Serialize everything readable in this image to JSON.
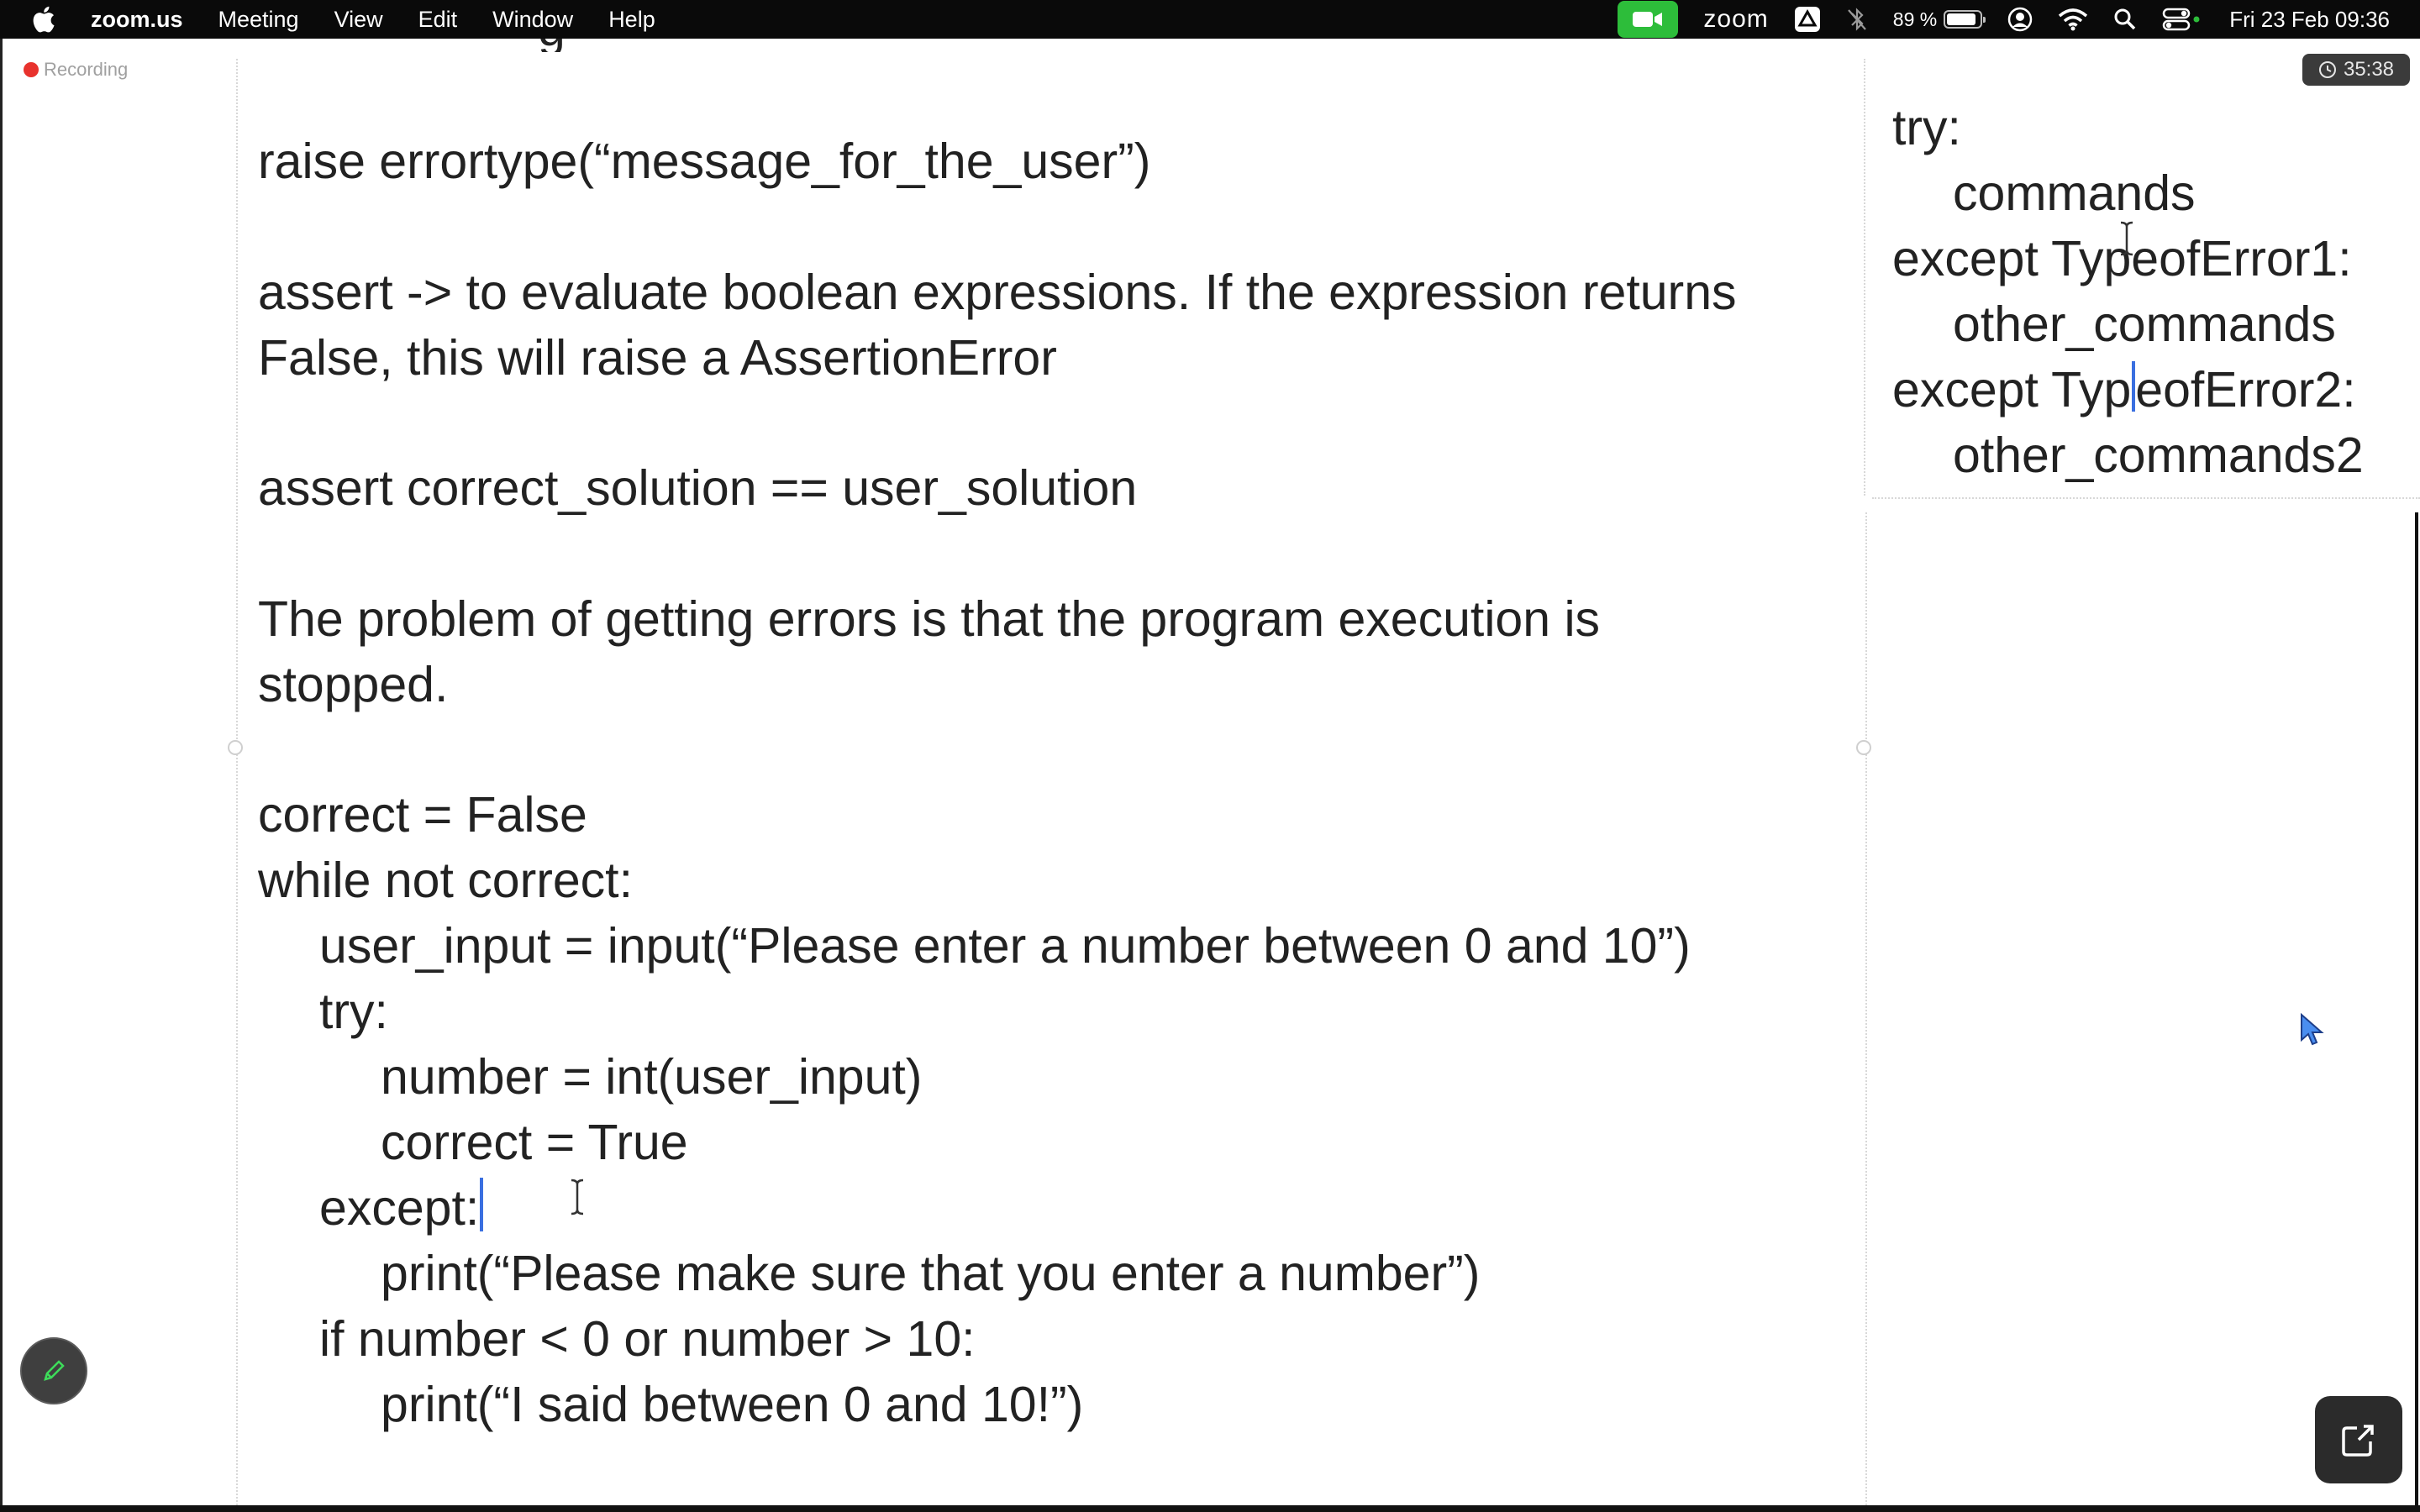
{
  "menubar": {
    "app_name": "zoom.us",
    "menus": [
      "Meeting",
      "View",
      "Edit",
      "Window",
      "Help"
    ],
    "zoom_label": "zoom",
    "battery_percent": "89 %",
    "battery_level": 0.89,
    "clock": "Fri 23 Feb  09:36"
  },
  "recording": {
    "label": "Recording"
  },
  "timer": {
    "elapsed": "35:38"
  },
  "document": {
    "lines": [
      "raise errortype(“message_for_the_user”)",
      "assert -> to evaluate boolean expressions. If the expression returns",
      "False, this will raise a AssertionError",
      "assert correct_solution == user_solution",
      "The problem of getting errors is that the program execution is",
      "stopped.",
      "correct = False",
      "while not correct:",
      "user_input = input(“Please enter a number between 0  and 10”)",
      "try:",
      "number = int(user_input)",
      "correct = True",
      "except:",
      "print(“Please make sure that you enter a number”)",
      "if number < 0 or number > 10:",
      "print(“I said between 0 and 10!”)"
    ]
  },
  "sidebar_note": {
    "line_try": "try:",
    "line_commands": "commands",
    "line_except1": "except TypeofError1:",
    "line_other1": "other_commands",
    "line_except2_a": "except Typ",
    "line_except2_b": "eofError2:",
    "line_other2": "other_commands2"
  },
  "colors": {
    "menubar_bg": "#0a0a0a",
    "zoom_green": "#2dbd3a",
    "recording_red": "#e8322d",
    "text_cursor": "#3a6fe0",
    "mouse_pointer": "#4a8ef0"
  }
}
